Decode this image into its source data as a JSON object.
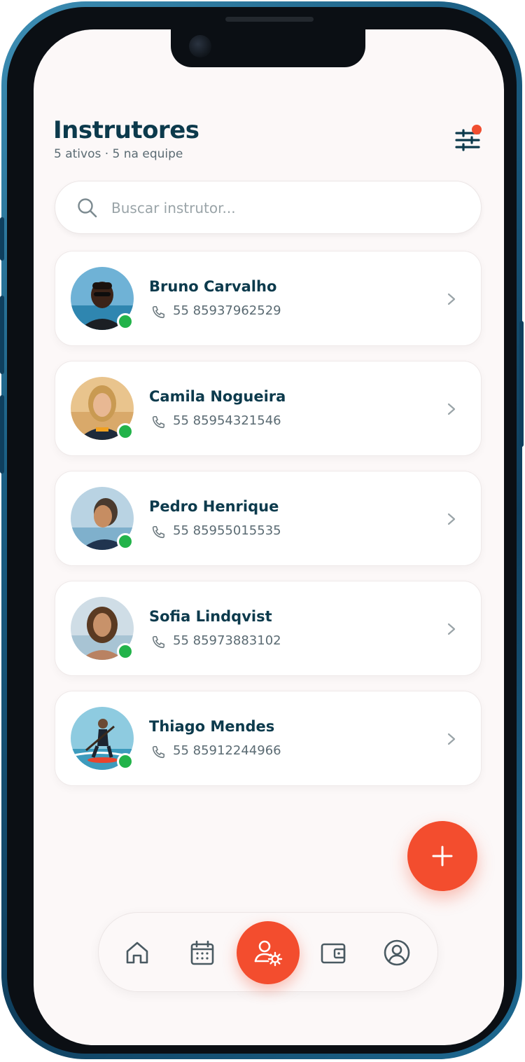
{
  "header": {
    "title": "Instrutores",
    "subtitle": "5 ativos · 5 na equipe",
    "filter_icon": "sliders-icon",
    "filter_has_notification": true
  },
  "search": {
    "placeholder": "Buscar instrutor...",
    "value": ""
  },
  "instructors": [
    {
      "name": "Bruno Carvalho",
      "phone": "55 85937962529",
      "online": true
    },
    {
      "name": "Camila Nogueira",
      "phone": "55 85954321546",
      "online": true
    },
    {
      "name": "Pedro Henrique",
      "phone": "55 85955015535",
      "online": true
    },
    {
      "name": "Sofia Lindqvist",
      "phone": "55 85973883102",
      "online": true
    },
    {
      "name": "Thiago Mendes",
      "phone": "55 85912244966",
      "online": true
    }
  ],
  "fab": {
    "icon": "plus-icon"
  },
  "bottom_nav": {
    "items": [
      {
        "icon": "home-icon",
        "active": false
      },
      {
        "icon": "calendar-icon",
        "active": false
      },
      {
        "icon": "user-gear-icon",
        "active": true
      },
      {
        "icon": "wallet-icon",
        "active": false
      },
      {
        "icon": "profile-icon",
        "active": false
      }
    ]
  },
  "colors": {
    "accent": "#f34d2e",
    "primary_text": "#0c3a4c",
    "online": "#22b34a",
    "background": "#fcf8f8"
  }
}
